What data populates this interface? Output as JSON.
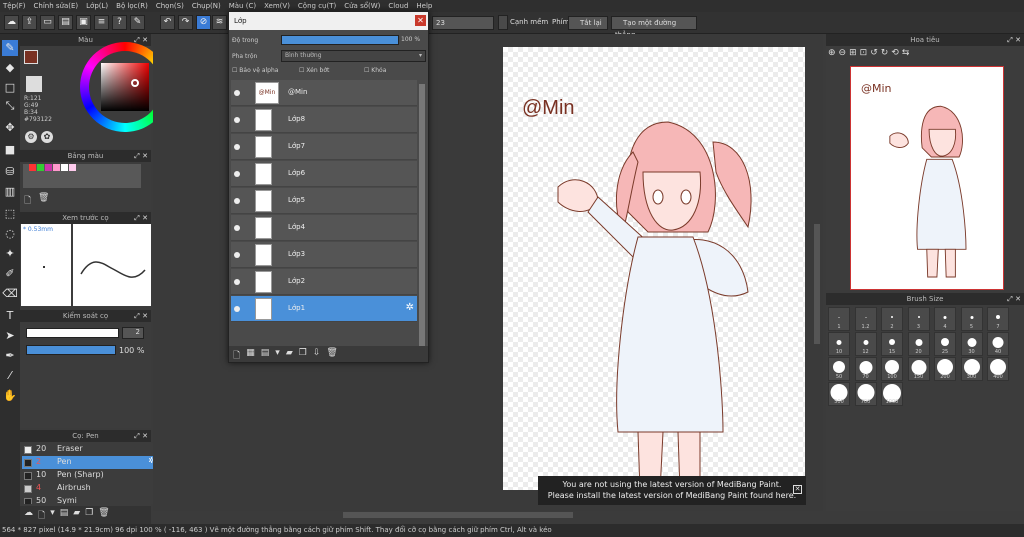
{
  "menu": [
    "Tệp(F)",
    "Chỉnh sửa(E)",
    "Lớp(L)",
    "Bộ lọc(R)",
    "Chọn(S)",
    "Chụp(N)",
    "Màu (C)",
    "Xem(V)",
    "Cộng cụ(T)",
    "Cửa sổ(W)",
    "Cloud",
    "Help"
  ],
  "toolbar": {
    "size_value": "23",
    "antialias_label": "Cạnh mềm",
    "snap_label": "Phím",
    "snap_off_label": "Tắt lại",
    "straight_line_label": "Tạo một đường thẳng"
  },
  "color_panel": {
    "title": "Màu",
    "r": "R:121",
    "g": "G:49",
    "b": "B:34",
    "hex": "#793122",
    "primary_color": "#793122"
  },
  "palette_panel": {
    "title": "Bảng màu",
    "swatches": [
      "#ff3333",
      "#33cc33",
      "#cc33aa",
      "#ff99cc",
      "#ffffff",
      "#ffccee"
    ]
  },
  "preview_panel": {
    "title": "Xem trước cọ",
    "size_text": "* 0.53mm"
  },
  "brush_control": {
    "title": "Kiểm soát cọ",
    "size_value": "2",
    "opacity_value": "100 %"
  },
  "brush_list": {
    "title": "Cọ: Pen",
    "items": [
      {
        "size": "20",
        "name": "Eraser"
      },
      {
        "size": "2",
        "name": "Pen",
        "selected": true
      },
      {
        "size": "10",
        "name": "Pen (Sharp)"
      },
      {
        "size": "4",
        "name": "Airbrush"
      },
      {
        "size": "50",
        "name": "Symi"
      }
    ]
  },
  "layer_dialog": {
    "title": "Lớp",
    "opacity_label": "Độ trong",
    "opacity_value": "100 %",
    "blend_label": "Pha trộn",
    "blend_value": "Bình thường",
    "protect_alpha": "Bảo vệ alpha",
    "clipping": "Xén bớt",
    "lock": "Khóa",
    "layers": [
      {
        "name": "@Min",
        "thumb": "@Min"
      },
      {
        "name": "Lớp8"
      },
      {
        "name": "Lớp7"
      },
      {
        "name": "Lớp6"
      },
      {
        "name": "Lớp5"
      },
      {
        "name": "Lớp4"
      },
      {
        "name": "Lớp3"
      },
      {
        "name": "Lớp2"
      },
      {
        "name": "Lớp1",
        "selected": true
      }
    ]
  },
  "canvas": {
    "watermark": "@Min"
  },
  "navigator": {
    "title": "Hoa tiêu",
    "watermark": "@Min"
  },
  "brush_size_panel": {
    "title": "Brush Size",
    "sizes": [
      "1",
      "1.2",
      "2",
      "3",
      "4",
      "5",
      "7",
      "10",
      "12",
      "15",
      "20",
      "25",
      "30",
      "40",
      "50",
      "70",
      "100",
      "150",
      "200",
      "300",
      "400",
      "500",
      "700",
      "1000"
    ]
  },
  "notice": {
    "line1": "You are not using the latest version of MediBang Paint.",
    "line2": "Please install the latest version of MediBang Paint found here."
  },
  "status": "564 * 827 pixel   (14.9 * 21.9cm)   96 dpi   100 %   ( -116, 463 )   Vẽ một đường thẳng bằng cách giữ phím Shift. Thay đổi cỡ cọ bằng cách giữ phím Ctrl, Alt và kéo"
}
